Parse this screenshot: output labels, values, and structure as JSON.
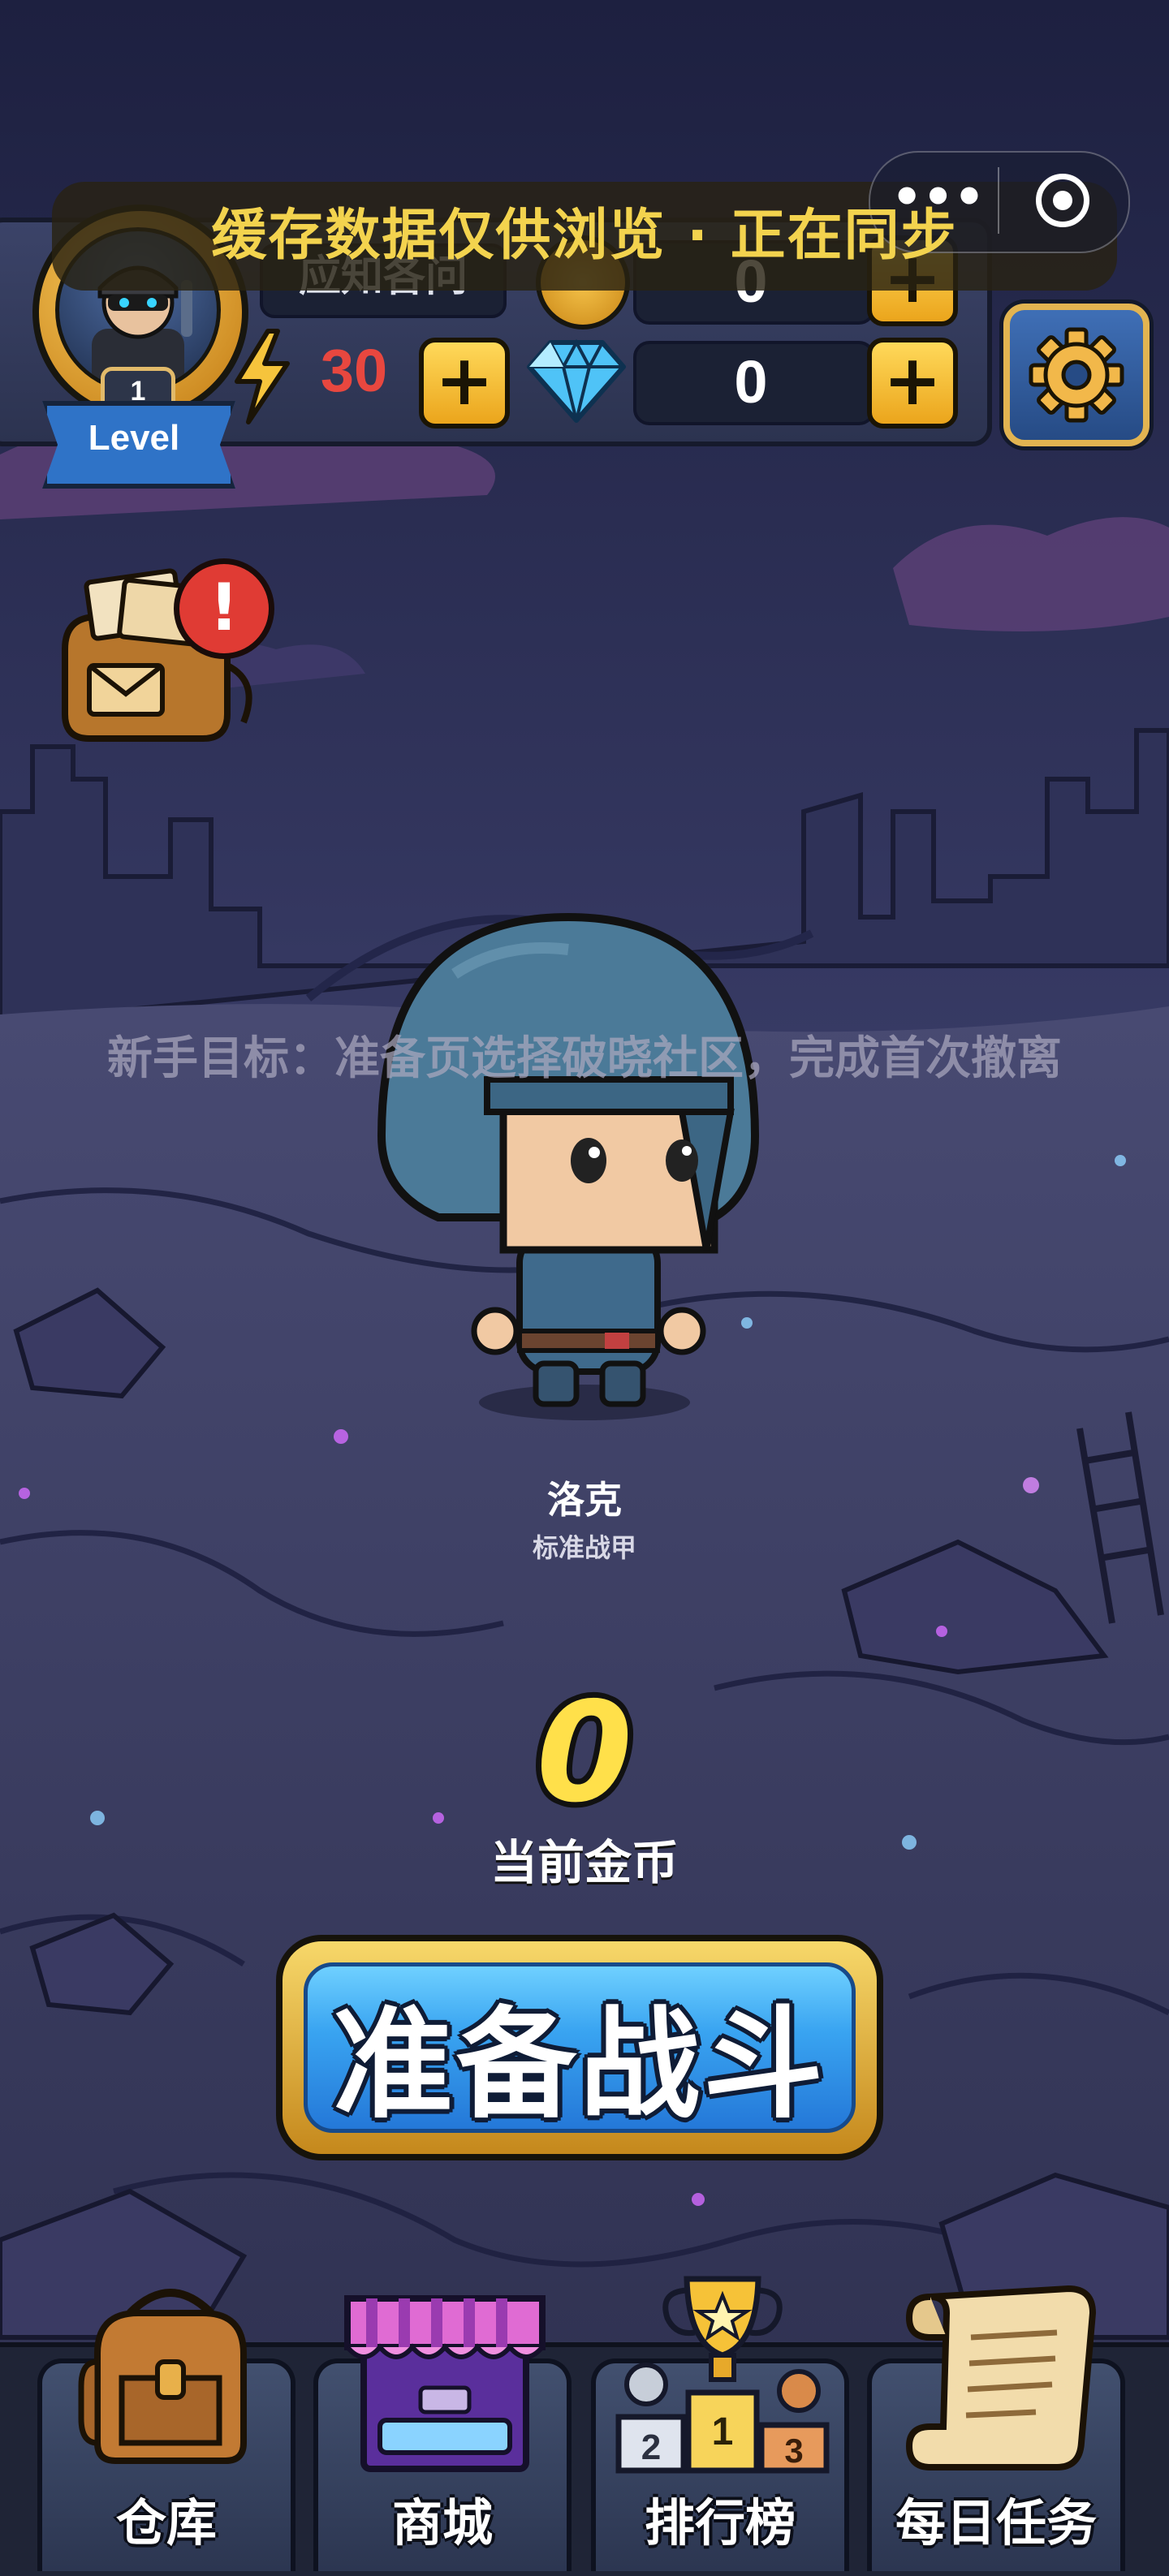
{
  "header": {
    "player_name": "应知各问",
    "level_number": "1",
    "level_label": "Level",
    "energy": "30",
    "gold": "0",
    "diamonds": "0",
    "plus_symbol": "+"
  },
  "sync_banner": {
    "text": "缓存数据仅供浏览 · 正在同步"
  },
  "mini_program_capsule": {
    "more_symbol": "•••"
  },
  "mail": {
    "alert_symbol": "!"
  },
  "center": {
    "goal_text": "新手目标：准备页选择破晓社区，完成首次撤离",
    "hero_name": "洛克",
    "hero_armor": "标准战甲",
    "current_coins": "0",
    "current_coins_label": "当前金币",
    "battle_button_label": "准备战斗"
  },
  "nav": {
    "items": [
      {
        "label": "仓库",
        "icon": "backpack-icon"
      },
      {
        "label": "商城",
        "icon": "shop-stall-icon"
      },
      {
        "label": "排行榜",
        "icon": "trophy-podium-icon"
      },
      {
        "label": "每日任务",
        "icon": "scroll-icon"
      }
    ]
  },
  "colors": {
    "energy_value": "#e8473f",
    "gold_accent": "#f3d34e",
    "button_blue": "#39a4f1",
    "panel_dark": "#1b2134"
  }
}
